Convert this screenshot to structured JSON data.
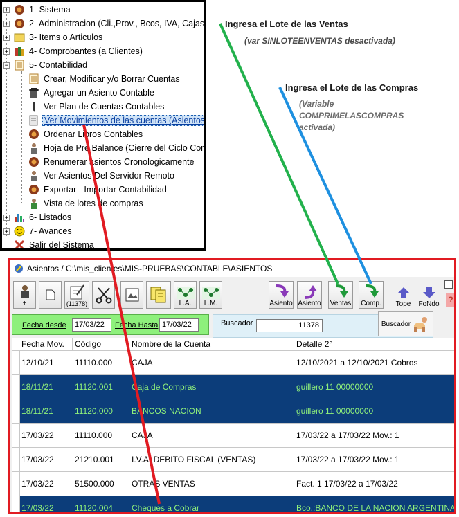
{
  "tree": {
    "items": [
      {
        "label": "1- Sistema"
      },
      {
        "label": "2- Administracion (Cli.,Prov., Bcos, IVA, Cajas)"
      },
      {
        "label": "3- Items o Articulos"
      },
      {
        "label": "4- Comprobantes (a Clientes)"
      },
      {
        "label": "5- Contabilidad"
      },
      {
        "label": "Crear, Modificar y/o Borrar Cuentas"
      },
      {
        "label": "Agregar un Asiento Contable"
      },
      {
        "label": "Ver Plan de Cuentas Contables"
      },
      {
        "label": "Ver Movimientos de las cuentas (Asientos)"
      },
      {
        "label": "Ordenar Libros Contables"
      },
      {
        "label": "Hoja de Pre Balance (Cierre del Ciclo Cont"
      },
      {
        "label": "Renumerar asientos Cronologicamente"
      },
      {
        "label": "Ver Asientos Del Servidor Remoto"
      },
      {
        "label": "Exportar - Importar Contabilidad"
      },
      {
        "label": "Vista de lotes de compras"
      },
      {
        "label": "6- Listados"
      },
      {
        "label": "7- Avances"
      },
      {
        "label": "Salir del Sistema"
      }
    ]
  },
  "annotations": {
    "ventas_title": "Ingresa el Lote de las Ventas",
    "ventas_note": "(var SINLOTEENVENTAS desactivada)",
    "compras_title": "Ingresa el Lote de las Compras",
    "compras_note_1": "(Variable",
    "compras_note_2": "COMPRIMELASCOMPRAS",
    "compras_note_3": "activada)",
    "colors": {
      "green_arrow": "#22b14c",
      "blue_arrow": "#1e90e0",
      "red_arrow": "#e11b22"
    }
  },
  "window": {
    "title": "Asientos / C:\\mis_clientes\\MIS-PRUEBAS\\CONTABLE\\ASIENTOS",
    "toolbar": {
      "add_label": "+",
      "count_label": "(11378)",
      "la_label": "L.A.",
      "lm_label": "L.M.",
      "asiento1_label": "Asiento",
      "asiento2_label": "Asiento",
      "ventas_label": "Ventas",
      "comp_label": "Comp.",
      "tope_label": "Tope",
      "fondo_label": "FoNdo",
      "help_label": "?"
    },
    "filter": {
      "desde_label": "Fecha desde",
      "desde_value": "17/03/22",
      "hasta_label": "Fecha Hasta",
      "hasta_value": "17/03/22"
    },
    "search": {
      "label": "Buscador",
      "value": "11378",
      "button_label": "Buscador"
    },
    "grid": {
      "headers": [
        "Fecha Mov.",
        "Código",
        "Nombre de la Cuenta",
        "Detalle 2°"
      ],
      "rows": [
        {
          "fecha": "12/10/21",
          "codigo": "11110.000",
          "nombre": "CAJA",
          "detalle": "12/10/2021 a 12/10/2021 Cobros",
          "selected": false
        },
        {
          "fecha": "18/11/21",
          "codigo": "11120.001",
          "nombre": "Caja de Compras",
          "detalle": "guillero 11 00000000",
          "selected": true
        },
        {
          "fecha": "18/11/21",
          "codigo": "11120.000",
          "nombre": "BANCOS NACION",
          "detalle": "guillero 11 00000000",
          "selected": true
        },
        {
          "fecha": "17/03/22",
          "codigo": "11110.000",
          "nombre": "CAJA",
          "detalle": "17/03/22 a 17/03/22 Mov.: 1",
          "selected": false
        },
        {
          "fecha": "17/03/22",
          "codigo": "21210.001",
          "nombre": "I.V.A. DEBITO FISCAL (VENTAS)",
          "detalle": "17/03/22 a 17/03/22 Mov.: 1",
          "selected": false
        },
        {
          "fecha": "17/03/22",
          "codigo": "51500.000",
          "nombre": "OTRAS VENTAS",
          "detalle": "Fact. 1 17/03/22 a 17/03/22",
          "selected": false
        },
        {
          "fecha": "17/03/22",
          "codigo": "11120.004",
          "nombre": "Cheques a Cobrar",
          "detalle": "Bco.:BANCO DE LA NACION ARGENTINA",
          "selected": true
        }
      ]
    }
  }
}
